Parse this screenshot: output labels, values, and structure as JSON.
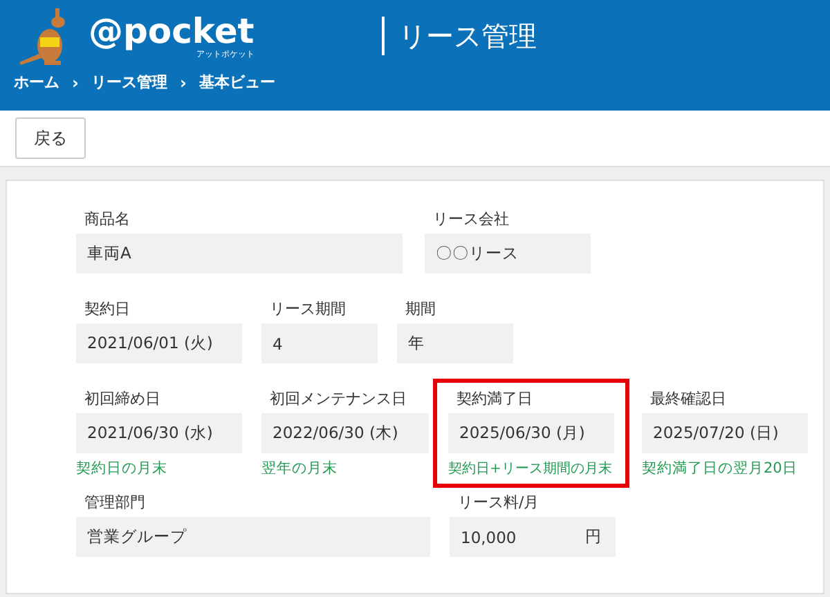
{
  "header": {
    "logo_text": "@pocket",
    "logo_subtext": "アットポケット",
    "title": "リース管理"
  },
  "breadcrumb": [
    "ホーム",
    "リース管理",
    "基本ビュー"
  ],
  "breadcrumb_separator": "›",
  "toolbar": {
    "back_button": "戻る"
  },
  "rows": [
    {
      "fields": [
        {
          "label": "商品名",
          "value": "車両A",
          "highlighted": false
        },
        {
          "label": "リース会社",
          "value": "〇〇リース",
          "highlighted": false
        }
      ]
    },
    {
      "fields": [
        {
          "label": "契約日",
          "value": "2021/06/01 (火)",
          "highlighted": false
        },
        {
          "label": "リース期間",
          "value": "4",
          "highlighted": false
        },
        {
          "label": "期間",
          "value": "年",
          "highlighted": false
        }
      ]
    },
    {
      "fields": [
        {
          "label": "初回締め日",
          "value": "2021/06/30 (水)",
          "note": "契約日の月末",
          "highlighted": false
        },
        {
          "label": "初回メンテナンス日",
          "value": "2022/06/30 (木)",
          "note": "翌年の月末",
          "highlighted": false
        },
        {
          "label": "契約満了日",
          "value": "2025/06/30 (月)",
          "note": "契約日+リース期間の月末",
          "highlighted": true
        },
        {
          "label": "最終確認日",
          "value": "2025/07/20 (日)",
          "note": "契約満了日の翌月20日",
          "highlighted": false
        }
      ]
    },
    {
      "fields": [
        {
          "label": "管理部門",
          "value": "営業グループ",
          "highlighted": false
        },
        {
          "label": "リース料/月",
          "value": "10,000",
          "unit": "円",
          "highlighted": false
        }
      ]
    }
  ]
}
